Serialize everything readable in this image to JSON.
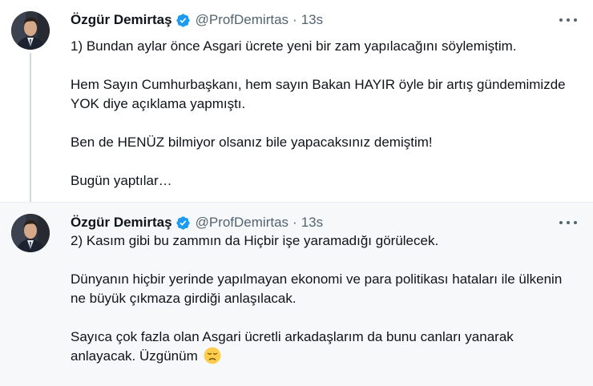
{
  "colors": {
    "text": "#0f1419",
    "muted": "#536471",
    "verified_blue": "#1d9bf0",
    "thread_line": "#cfd9de",
    "second_bg": "#f7f8f9"
  },
  "tweets": [
    {
      "author": {
        "name": "Özgür Demirtaş",
        "handle": "@ProfDemirtas",
        "verified_icon": "verified-badge-icon",
        "avatar_icon": "profile-photo"
      },
      "separator": "·",
      "time": "13s",
      "more_icon": "more-options-icon",
      "paragraphs": [
        "1) Bundan aylar önce Asgari ücrete yeni bir zam yapılacağını söylemiştim.",
        "Hem Sayın Cumhurbaşkanı, hem sayın Bakan HAYIR öyle bir artış gündemimizde YOK diye açıklama yapmıştı.",
        "Ben de HENÜZ bilmiyor olsanız bile yapacaksınız demiştim!",
        "Bugün yaptılar…"
      ]
    },
    {
      "author": {
        "name": "Özgür Demirtaş",
        "handle": "@ProfDemirtas",
        "verified_icon": "verified-badge-icon",
        "avatar_icon": "profile-photo"
      },
      "separator": "·",
      "time": "13s",
      "more_icon": "more-options-icon",
      "paragraphs": [
        "2) Kasım gibi bu zammın da Hiçbir işe yaramadığı görülecek.",
        "Dünyanın hiçbir yerinde yapılmayan ekonomi ve para politikası hataları ile ülkenin ne büyük çıkmaza girdiği anlaşılacak.",
        "Sayıca çok fazla olan Asgari ücretli arkadaşlarım da bunu canları yanarak anlayacak. Üzgünüm"
      ],
      "trailing_emoji": "disappointed-face-emoji"
    }
  ]
}
